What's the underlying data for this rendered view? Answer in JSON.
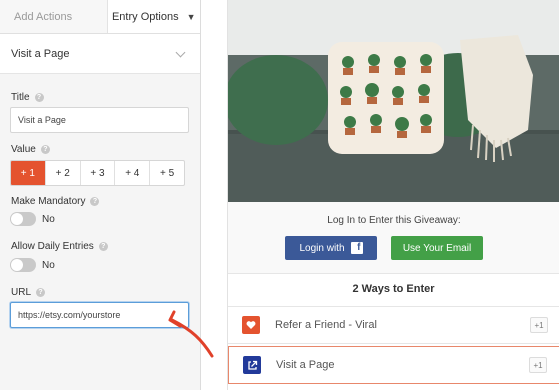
{
  "tabs": {
    "add_actions": "Add Actions",
    "entry_options": "Entry Options"
  },
  "section": {
    "title": "Visit a Page"
  },
  "form": {
    "title_label": "Title",
    "title_value": "Visit a Page",
    "value_label": "Value",
    "value_options": [
      "+ 1",
      "+ 2",
      "+ 3",
      "+ 4",
      "+ 5"
    ],
    "value_selected": "+ 1",
    "mandatory_label": "Make Mandatory",
    "mandatory_state": "No",
    "daily_label": "Allow Daily Entries",
    "daily_state": "No",
    "url_label": "URL",
    "url_value": "https://etsy.com/yourstore"
  },
  "preview": {
    "login_title": "Log In to Enter this Giveaway:",
    "login_facebook": "Login with",
    "facebook_icon_letter": "f",
    "login_email": "Use Your Email",
    "ways_title": "2 Ways to Enter",
    "entries": [
      {
        "label": "Refer a Friend - Viral",
        "badge": "+1",
        "icon": "heart-icon"
      },
      {
        "label": "Visit a Page",
        "badge": "+1",
        "icon": "external-link-icon"
      }
    ]
  },
  "colors": {
    "accent_orange": "#e4532f",
    "facebook_blue": "#3b5998",
    "email_green": "#43a047",
    "visit_icon_blue": "#223a9a",
    "annotation_red": "#e0412a"
  }
}
